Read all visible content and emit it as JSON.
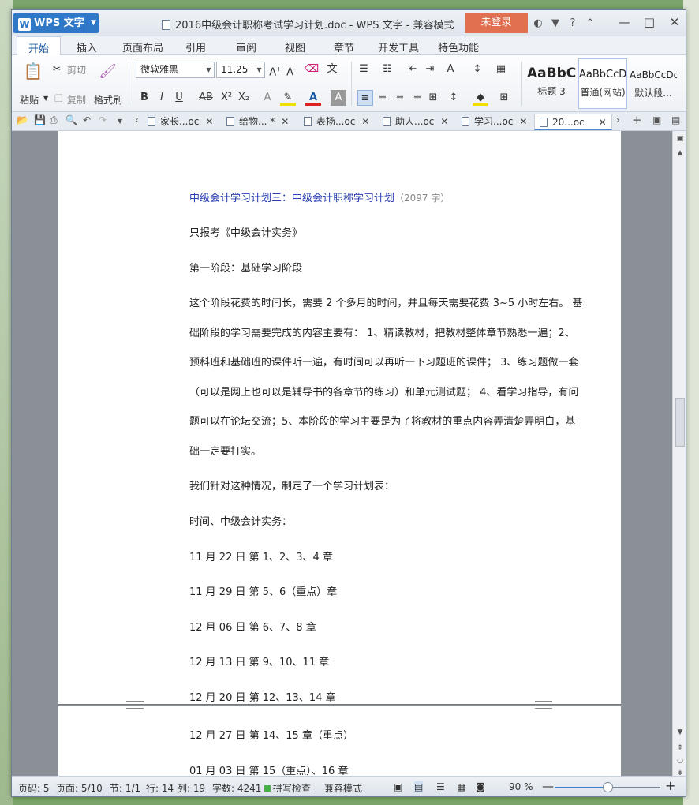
{
  "window": {
    "app_name": "WPS 文字",
    "app_logo": "W",
    "title": "2016中级会计职称考试学习计划.doc - WPS 文字 - 兼容模式",
    "login_label": "未登录"
  },
  "menu": {
    "tabs": [
      "开始",
      "插入",
      "页面布局",
      "引用",
      "审阅",
      "视图",
      "章节",
      "开发工具",
      "特色功能"
    ]
  },
  "ribbon": {
    "paste": "粘贴",
    "cut": "剪切",
    "copy": "复制",
    "format_painter": "格式刷",
    "font_name": "微软雅黑",
    "font_size": "11.25",
    "styles": [
      {
        "preview": "AaBbC",
        "name": "标题 3"
      },
      {
        "preview": "AaBbCcD",
        "name": "普通(网站)"
      },
      {
        "preview": "AaBbCcDd",
        "name": "默认段..."
      }
    ]
  },
  "doc_tabs": [
    "家长...oc",
    "给物... *",
    "表扬...oc",
    "助人...oc",
    "学习...oc",
    "20...oc"
  ],
  "document": {
    "heading": "中级会计学习计划三：中级会计职称学习计划",
    "heading_count": "（2097 字）",
    "paragraphs": [
      "只报考《中级会计实务》",
      "第一阶段：基础学习阶段",
      "这个阶段花费的时间长，需要 2 个多月的时间，并且每天需要花费 3~5 小时左右。 基",
      "础阶段的学习需要完成的内容主要有： 1、精读教材，把教材整体章节熟悉一遍；2、",
      "预科班和基础班的课件听一遍，有时间可以再听一下习题班的课件； 3、练习题做一套",
      "（可以是网上也可以是辅导书的各章节的练习）和单元测试题； 4、看学习指导，有问",
      "题可以在论坛交流；5、本阶段的学习主要是为了将教材的重点内容弄清楚弄明白，基",
      "础一定要打实。",
      "我们针对这种情况，制定了一个学习计划表：",
      "时间、中级会计实务：",
      "11 月 22 日  第 1、2、3、4 章",
      "11 月 29 日  第 5、6（重点）章",
      "12 月 06 日  第 6、7、8 章",
      "12 月 13 日  第 9、10、11 章",
      "12 月 20 日  第 12、13、14 章"
    ],
    "page2_paragraphs": [
      "12 月 27 日  第 14、15 章（重点）",
      "01 月 03 日  第 15（重点）、16 章"
    ]
  },
  "status": {
    "page_num": "页码: 5",
    "pages": "页面: 5/10",
    "section": "节: 1/1",
    "line": "行: 14",
    "col": "列: 19",
    "word_count": "字数: 4241",
    "spell_check": "拼写检查",
    "compat_mode": "兼容模式",
    "zoom": "90 %",
    "zoom_level": 0.5
  }
}
